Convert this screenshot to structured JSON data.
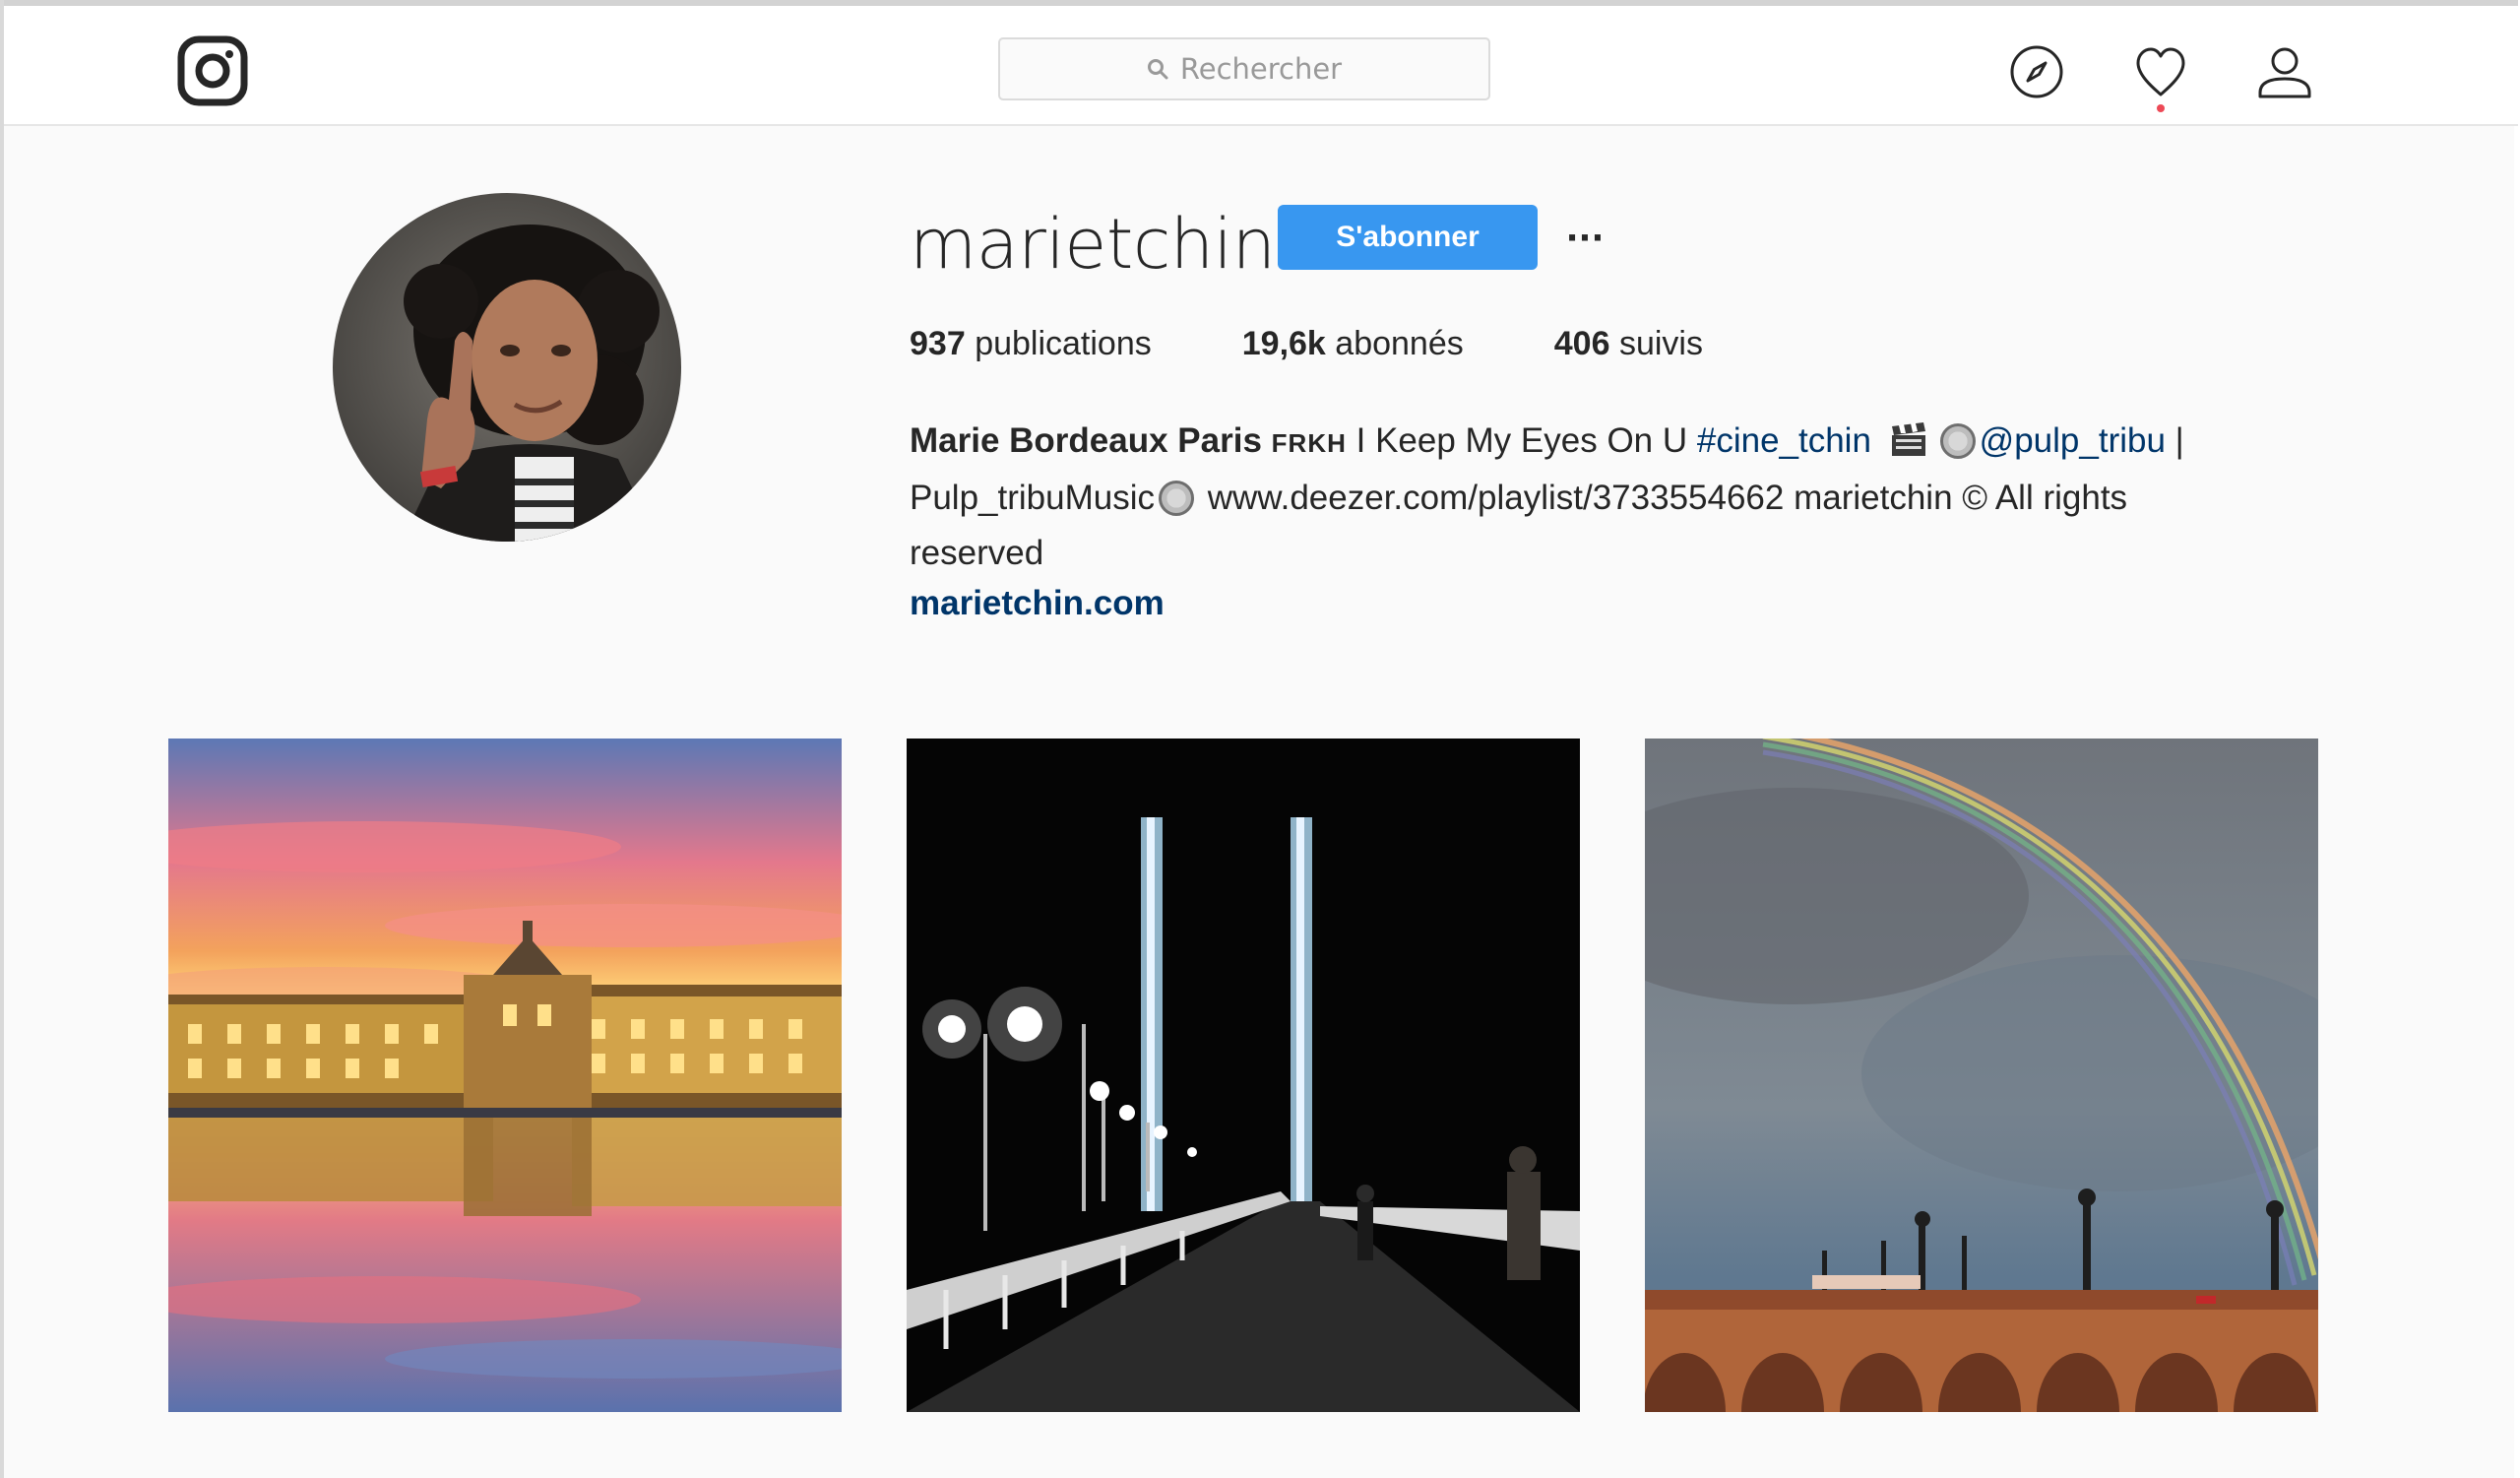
{
  "header": {
    "search_placeholder": "Rechercher",
    "icons": [
      "instagram-logo-icon",
      "search-icon",
      "compass-icon",
      "heart-icon",
      "user-icon"
    ],
    "notification_dot_color": "#ed4956"
  },
  "profile": {
    "username": "marietchin",
    "follow_label": "S'abonner",
    "more_label": "···",
    "stats": [
      {
        "count": "937",
        "label": "publications"
      },
      {
        "count": "19,6k",
        "label": "abonnés"
      },
      {
        "count": "406",
        "label": "suivis"
      }
    ],
    "bio": {
      "name": "Marie Bordeaux Paris",
      "tag": "FRKH",
      "text1": " I Keep My Eyes On U ",
      "hashtag": "#cine_tchin",
      "mention": "@pulp_tribu",
      "text2": " | Pulp_tribuMusic",
      "text3": " www.deezer.com/playlist/3733554662 marietchin © All rights reserved"
    },
    "website": "marietchin.com"
  },
  "colors": {
    "accent": "#3897f0",
    "link": "#003569"
  }
}
